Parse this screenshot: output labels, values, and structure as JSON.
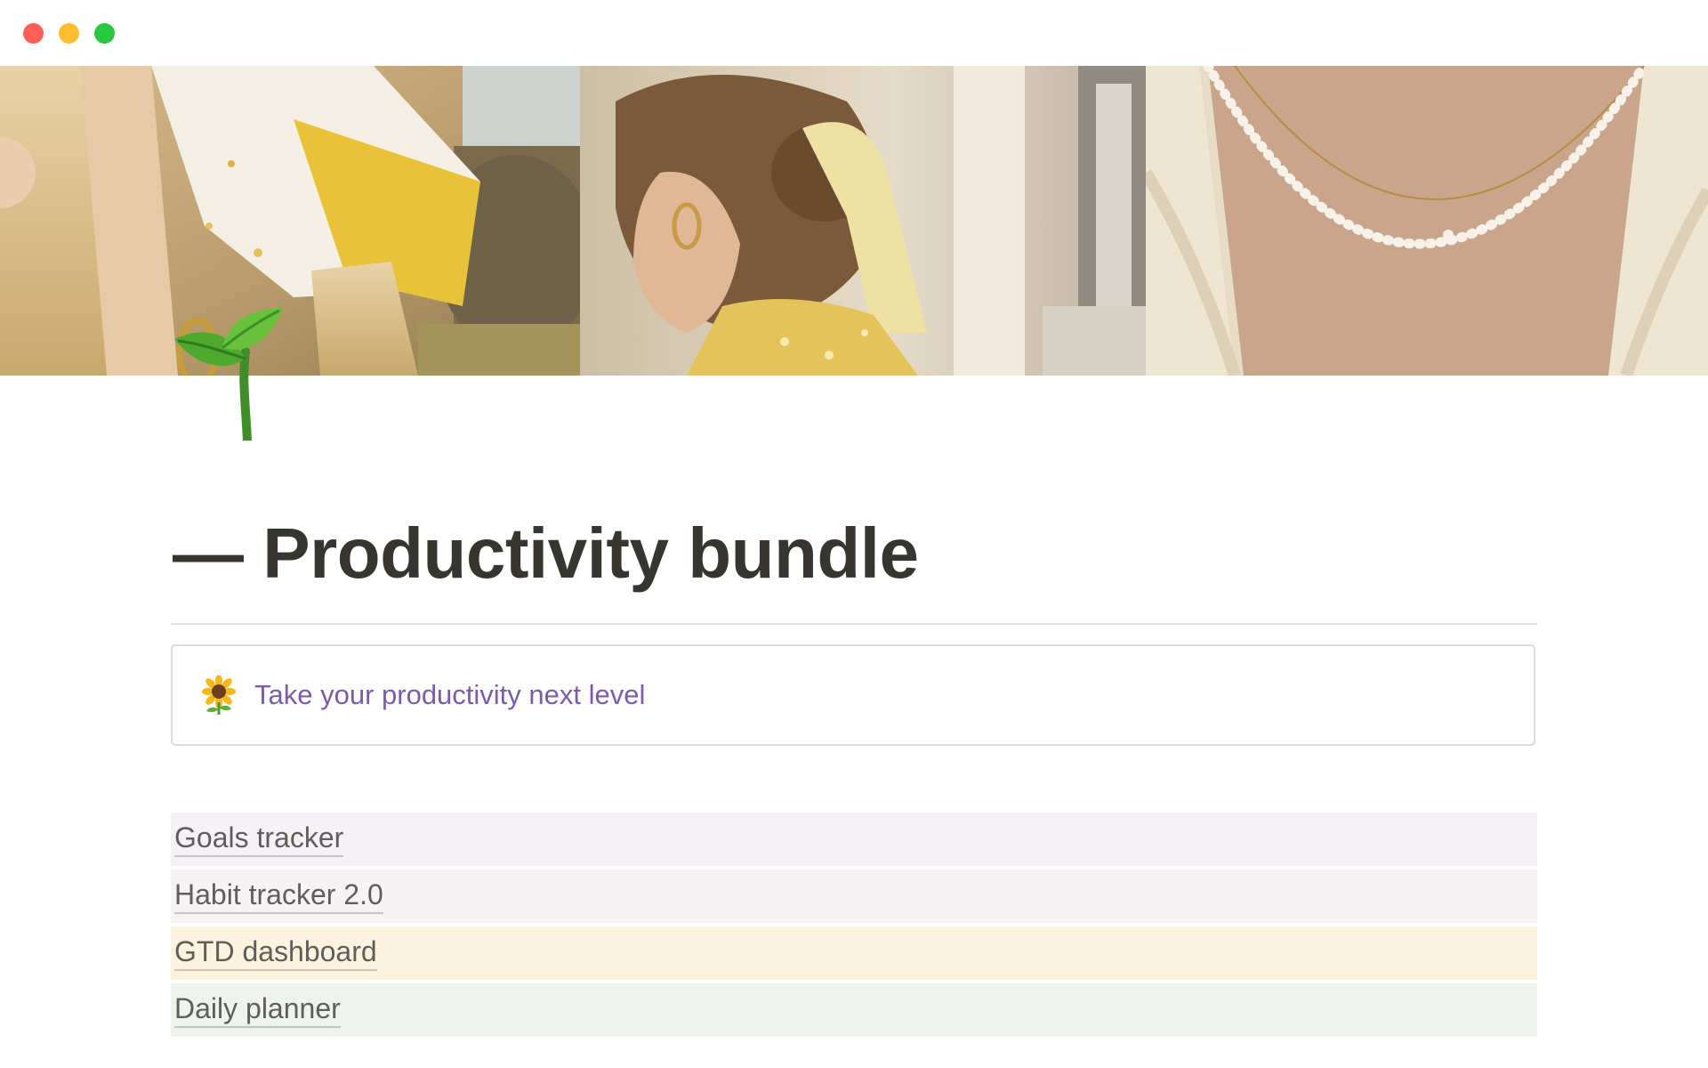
{
  "window": {
    "controls": {
      "close": "close",
      "minimize": "minimize",
      "zoom": "zoom"
    }
  },
  "cover": {
    "panels": [
      "blonde-hair-scarf-photo",
      "hair-bun-scarf-photo",
      "pearl-necklace-photo"
    ]
  },
  "page": {
    "icon": "seedling-icon",
    "title": "— Productivity bundle",
    "callout": {
      "icon": "sunflower-icon",
      "text": "Take your productivity next level",
      "text_color": "#7c5ca8"
    },
    "links": [
      {
        "label": "Goals tracker",
        "background": "#f4f2f7"
      },
      {
        "label": "Habit tracker 2.0",
        "background": "#f7f2f3"
      },
      {
        "label": "GTD dashboard",
        "background": "#faf3dd"
      },
      {
        "label": "Daily planner",
        "background": "#eef3ed"
      }
    ]
  },
  "colors": {
    "title": "#37352f",
    "link_text": "#5f5e5b",
    "divider": "#e3e2e0"
  }
}
